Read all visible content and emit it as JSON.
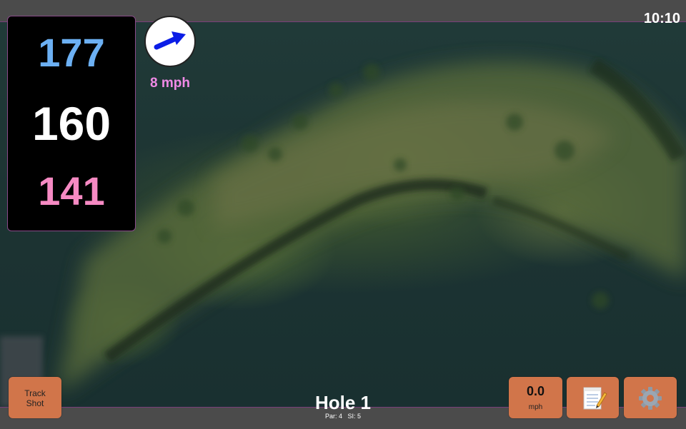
{
  "status_bar": {
    "time": "10:10"
  },
  "yardage": {
    "back": "177",
    "middle": "160",
    "front": "141"
  },
  "wind": {
    "speed_label": "8 mph",
    "icon": "wind-arrow-icon",
    "direction": "east-northeast"
  },
  "buttons": {
    "track_shot_line1": "Track",
    "track_shot_line2": "Shot",
    "speed_value": "0.0",
    "speed_unit": "mph",
    "notes_icon": "memo-icon",
    "settings_icon": "gear-icon"
  },
  "hole": {
    "title": "Hole 1",
    "par_label": "Par: 4",
    "si_label": "SI: 5"
  },
  "colors": {
    "back_yardage": "#6cb0f3",
    "middle_yardage": "#ffffff",
    "front_yardage": "#f68ac3",
    "wind_speed": "#f08ae6",
    "button": "#d1754a",
    "water": "#1d3433"
  }
}
